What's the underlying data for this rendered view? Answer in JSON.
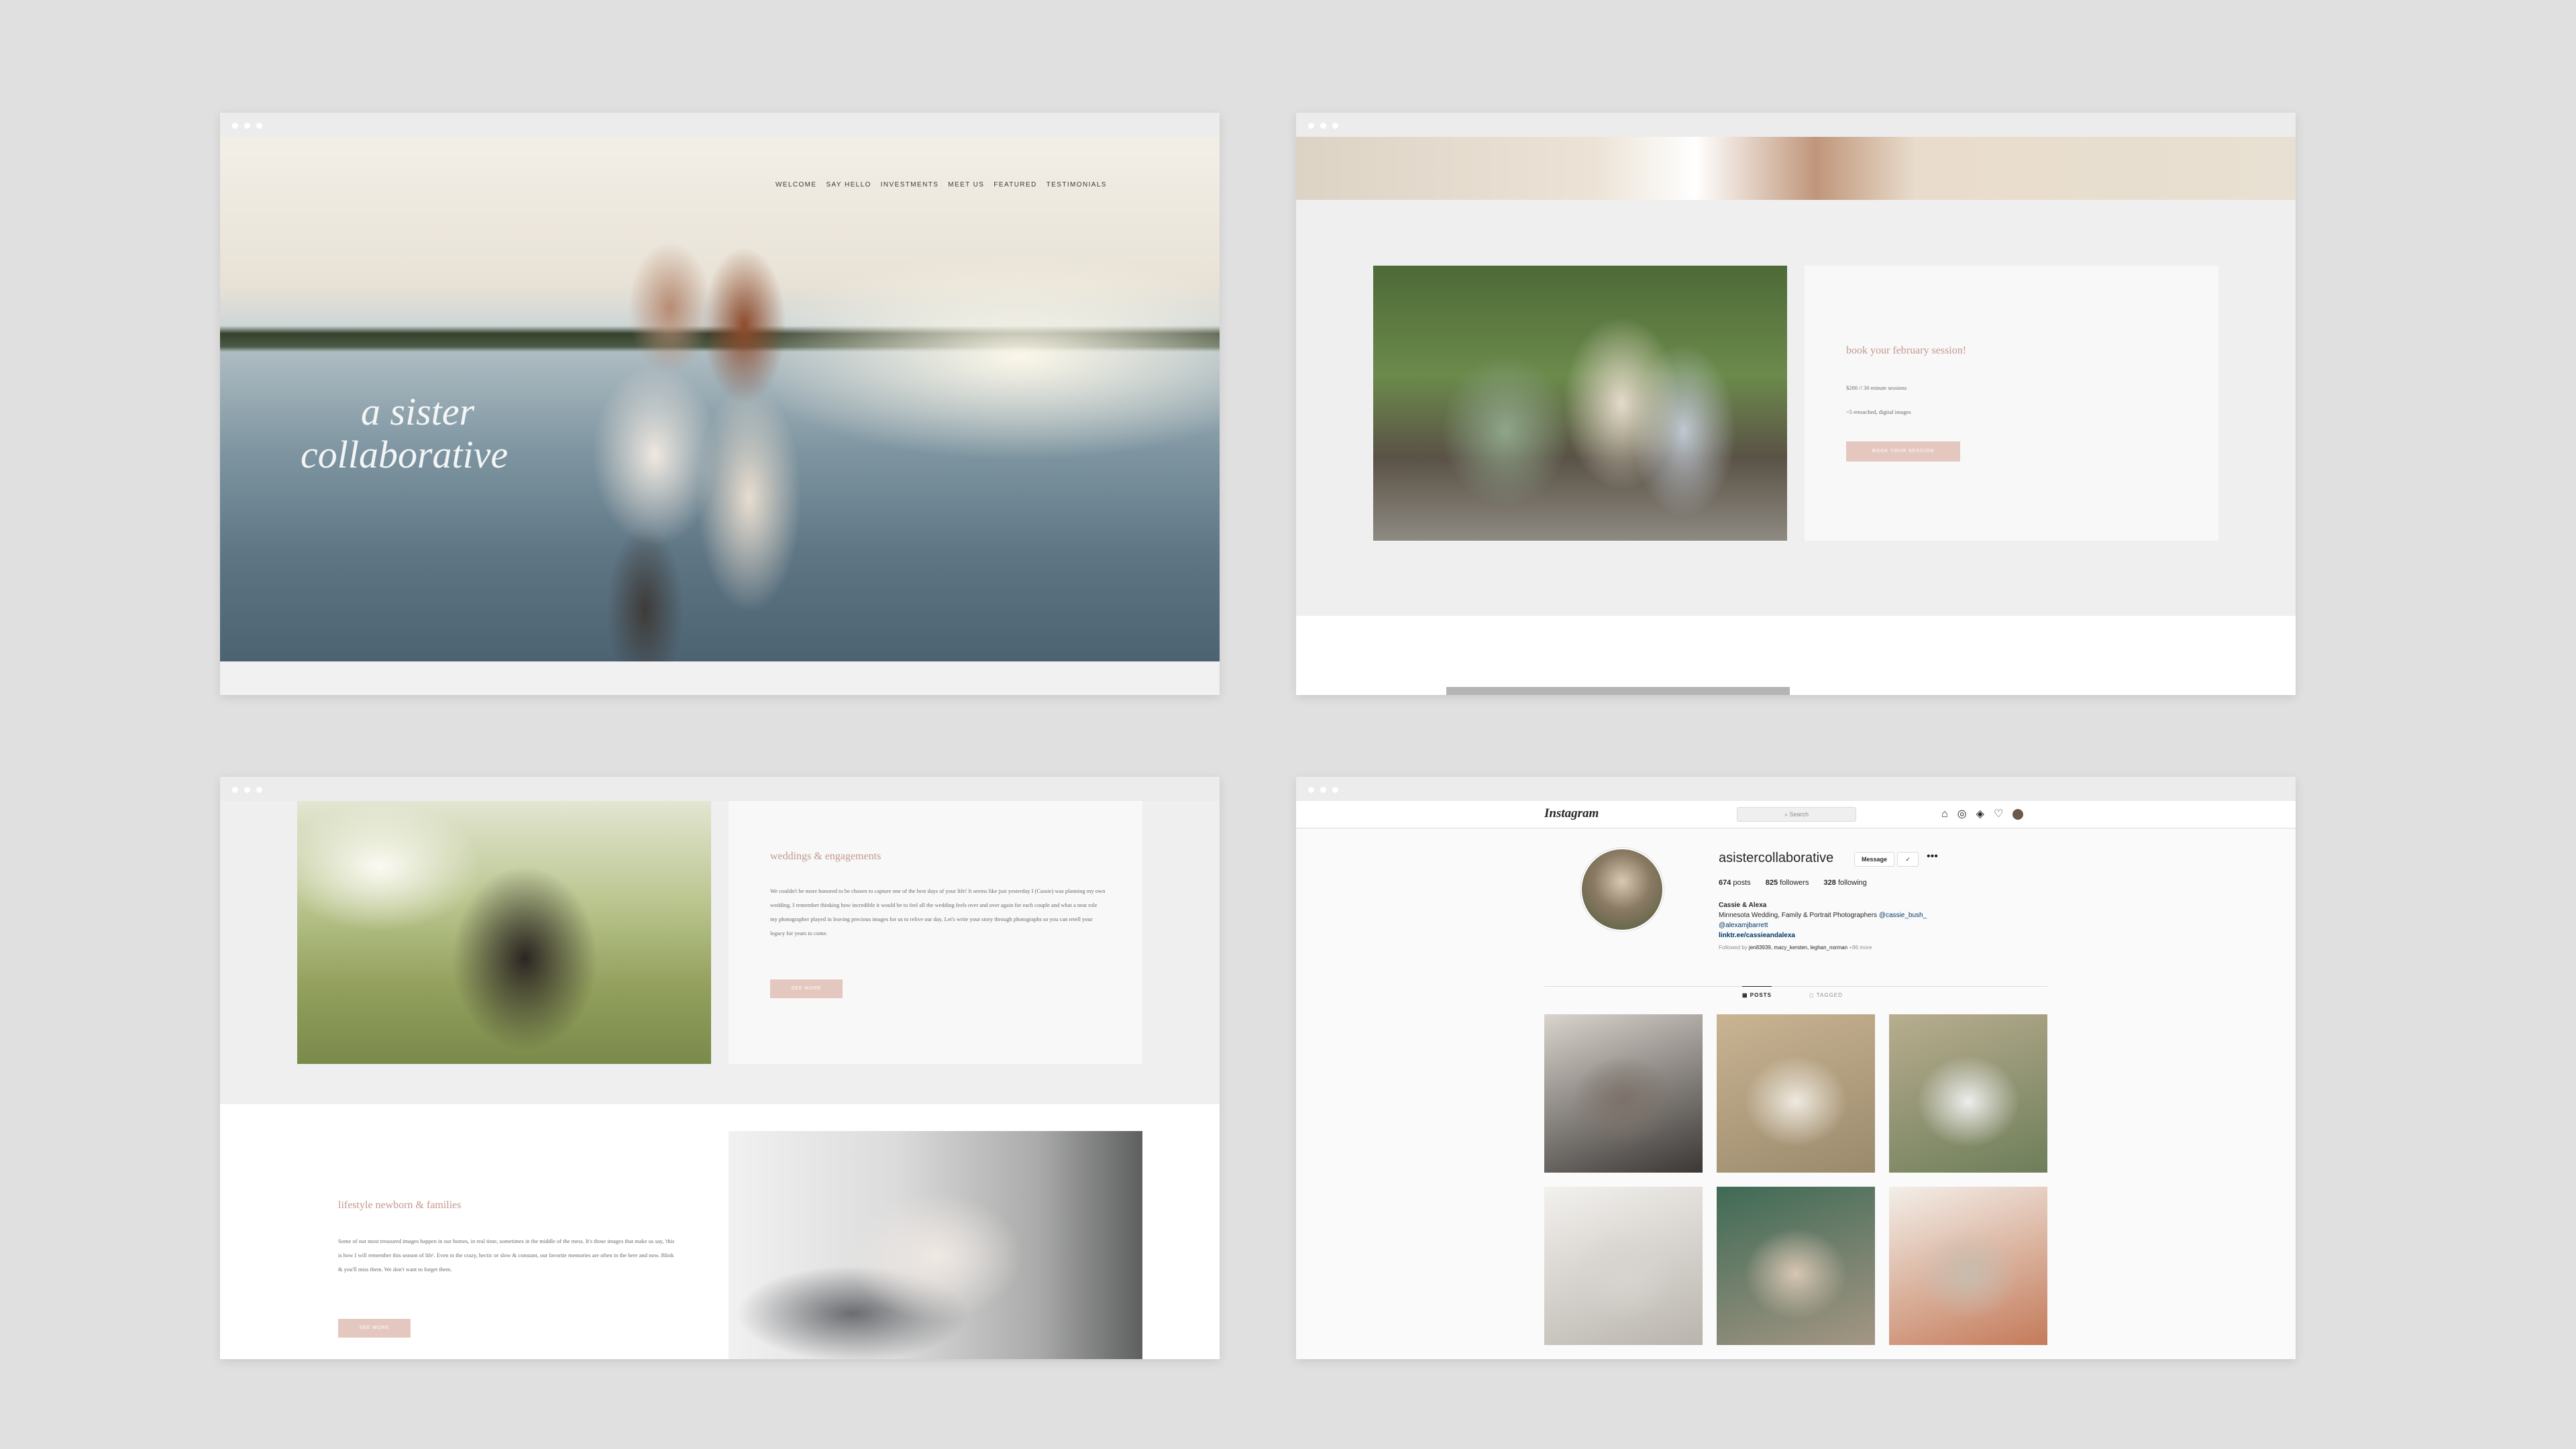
{
  "hero": {
    "nav": [
      "WELCOME",
      "SAY HELLO",
      "INVESTMENTS",
      "MEET US",
      "FEATURED",
      "TESTIMONIALS"
    ],
    "script_title_line1": "a sister",
    "script_title_line2": "collaborative"
  },
  "booking": {
    "title": "book your february session!",
    "line1": "$200 // 30 minute sessions",
    "line2": "~5 retouched, digital images",
    "button": "BOOK YOUR SESSION"
  },
  "services": {
    "weddings_title": "weddings & engagements",
    "weddings_body": "We couldn't be more honored to be chosen to capture one of the best days of your life! It seems like just yesterday I (Cassie) was planning my own wedding. I remember thinking how incredible it would be to feel all the wedding feels over and over again for each couple and what a neat role my photographer played in leaving precious images for us to relive our day. Let's write your story through photographs so you can retell your legacy for years to come.",
    "weddings_button": "SEE MORE",
    "newborn_title": "lifestyle newborn & families",
    "newborn_body": "Some of our most treasured images happen in our homes, in real time, sometimes in the middle of the mess. It's those images that make us say, 'this is how I will remember this season of life'. Even in the crazy, hectic or slow & constant, our favorite memories are often in the here and now. Blink & you'll miss them. We don't want to forget them.",
    "newborn_button": "SEE MORE"
  },
  "instagram": {
    "logo": "Instagram",
    "search_placeholder": "Search",
    "username": "asistercollaborative",
    "message_button": "Message",
    "posts_count": "674",
    "posts_label": "posts",
    "followers_count": "825",
    "followers_label": "followers",
    "following_count": "328",
    "following_label": "following",
    "display_name": "Cassie & Alexa",
    "bio_text": "Minnesota Wedding, Family & Portrait Photographers",
    "bio_mention1": "@cassie_bush_",
    "bio_mention2": "@alexamjbarrett",
    "bio_link": "linktr.ee/cassieandalexa",
    "followed_by_label": "Followed by",
    "followed_by": "jen83939, macy_kersten, leghan_norman",
    "followed_by_more": "+86 more",
    "tab_posts": "POSTS",
    "tab_tagged": "TAGGED",
    "thumbs": [
      "family-photo-thumb",
      "wedding-couple-thumb",
      "bride-field-thumb",
      "newborn-thumb",
      "kids-thumb",
      "detail-rings-thumb"
    ],
    "thumb_colors": [
      [
        "#d9d4cd",
        "#7d726a",
        "#3b3735"
      ],
      [
        "#c9b493",
        "#efe9df",
        "#9a8a6c"
      ],
      [
        "#b8ad8f",
        "#eeeeee",
        "#6e7e5a"
      ],
      [
        "#f3f1ee",
        "#d7d4cf",
        "#b9b4ad"
      ],
      [
        "#3e6a55",
        "#d7c6b3",
        "#a59684"
      ],
      [
        "#f3efe9",
        "#c8bcae",
        "#c47a59"
      ]
    ]
  }
}
